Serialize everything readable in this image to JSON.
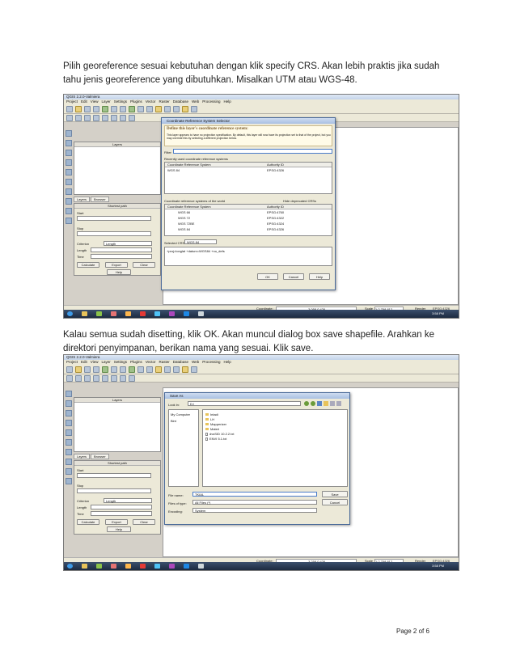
{
  "paragraph1": "Pilih georeference sesuai kebutuhan dengan klik specify CRS. Akan lebih praktis jika sudah tahu jenis georeference yang dibutuhkan. Misalkan UTM atau WGS-48.",
  "paragraph2": "Kalau semua sudah disetting, klik OK. Akan muncul dialog box save shapefile. Arahkan ke direktori penyimpanan, berikan nama yang sesuai. Klik save.",
  "qgis": {
    "window_title": "QGIS 2.2.0-Valmiera",
    "menu": [
      "Project",
      "Edit",
      "View",
      "Layer",
      "Settings",
      "Plugins",
      "Vector",
      "Raster",
      "Database",
      "Web",
      "Processing",
      "Help"
    ],
    "layers_panel_title": "Layers",
    "tabs": [
      "Layers",
      "Browser"
    ],
    "shortest_path_title": "Shortest path",
    "start_label": "Start",
    "stop_label": "Stop",
    "criterion_label": "Criterion",
    "criterion_value": "Length",
    "length_label": "Length",
    "time_label": "Time",
    "calculate_label": "Calculate",
    "export_label": "Export",
    "clear_label": "Clear",
    "help_label": "Help",
    "coordinate_label": "Coordinate:",
    "coordinate_value_1": "-3.058,0.426",
    "coordinate_value_2": "-3.258,0.426",
    "scale_label": "Scale",
    "scale_value": "1:2,758,812",
    "render_label": "Render",
    "epsg_badge": "EPSG:4326",
    "clock": "3:58 PM"
  },
  "crs_dialog": {
    "title": "Coordinate Reference System Selector",
    "heading": "Define this layer's coordinate reference system:",
    "description": "This layer appears to have no projection specification. By default, this layer will now have its projection set to that of the project, but you may override this by selecting a different projection below.",
    "filter_label": "Filter",
    "recent_label": "Recently used coordinate reference systems",
    "col_crs": "Coordinate Reference System",
    "col_authority": "Authority ID",
    "recent_rows": [
      {
        "name": "WGS 84",
        "id": "EPSG:4326"
      }
    ],
    "world_label": "Coordinate reference systems of the world",
    "hide_deprecated": "Hide deprecated CRSs",
    "world_rows": [
      {
        "name": "WGS 66",
        "id": "EPSG:4760"
      },
      {
        "name": "WGS 72",
        "id": "EPSG:4322"
      },
      {
        "name": "WGS 72BE",
        "id": "EPSG:4324"
      },
      {
        "name": "WGS 84",
        "id": "EPSG:4326"
      }
    ],
    "selected_label": "Selected CRS:",
    "selected_value": "WGS 84",
    "proj_string": "+proj=longlat +datum=WGS84 +no_defs",
    "ok": "OK",
    "cancel": "Cancel",
    "help": "Help"
  },
  "save_dialog": {
    "title": "Save As",
    "look_in_label": "Look in:",
    "look_in_value": "D:\\",
    "places": [
      "My Computer",
      "Bint"
    ],
    "files": [
      {
        "name": "Intadi",
        "type": "folder"
      },
      {
        "name": "LH",
        "type": "folder"
      },
      {
        "name": "Mapperizer",
        "type": "folder"
      },
      {
        "name": "Materi",
        "type": "folder"
      },
      {
        "name": "dvsSID 10.2.2.txt",
        "type": "file"
      },
      {
        "name": "ENVI 5.1.txt",
        "type": "file"
      }
    ],
    "file_name_label": "File name:",
    "file_name_value": "TKIAL",
    "files_of_type_label": "Files of type:",
    "files_of_type_value": "All Files (*)",
    "encoding_label": "Encoding:",
    "encoding_value": "System",
    "save": "Save",
    "cancel": "Cancel"
  },
  "page_number": "Page 2 of 6"
}
